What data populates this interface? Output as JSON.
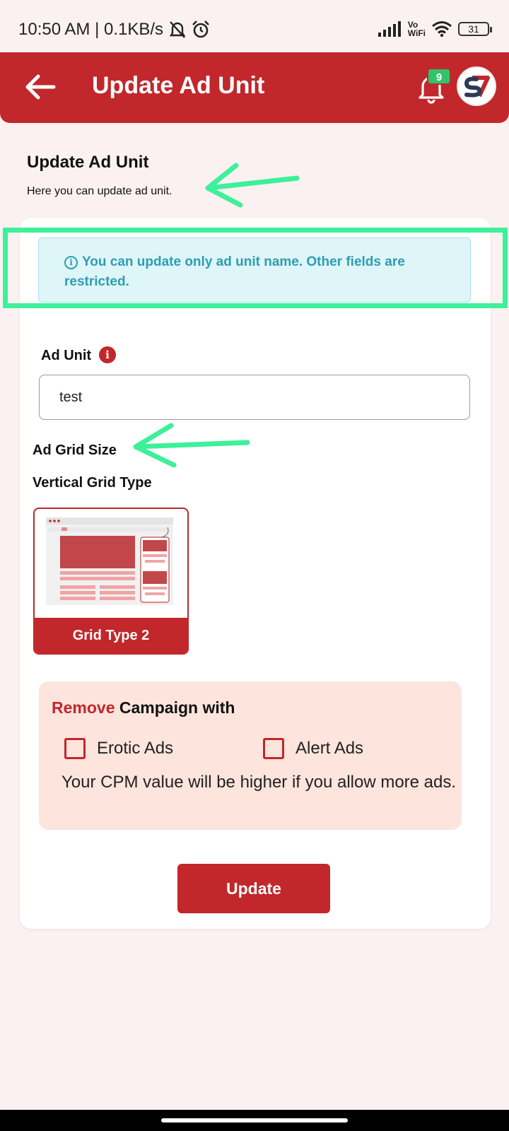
{
  "status_bar": {
    "time": "10:50 AM | 0.1KB/s",
    "vowifi_top": "Vo",
    "vowifi_bottom": "WiFi",
    "battery": "31"
  },
  "header": {
    "title": "Update Ad Unit",
    "notification_count": "9"
  },
  "page": {
    "title": "Update Ad Unit",
    "subtitle": "Here you can update ad unit."
  },
  "notice": {
    "text": "You can update only ad unit name. Other fields are restricted."
  },
  "form": {
    "ad_unit_label": "Ad Unit",
    "ad_unit_value": "test",
    "grid_size_label": "Ad Grid Size",
    "grid_type_label": "Vertical Grid Type",
    "grid_option_label": "Grid Type 2"
  },
  "campaign": {
    "title_highlight": "Remove",
    "title_rest": " Campaign with",
    "options": [
      {
        "label": "Erotic Ads",
        "checked": false
      },
      {
        "label": "Alert Ads",
        "checked": false
      }
    ],
    "note": "Your CPM value will be higher if you allow more ads."
  },
  "actions": {
    "update_label": "Update"
  },
  "colors": {
    "brand_red": "#c1272b",
    "annotation_green": "#3df09a",
    "notice_text": "#2e9db3",
    "campaign_bg": "#fde4dc"
  },
  "icons": [
    "back-arrow-icon",
    "bell-icon",
    "avatar-logo",
    "info-circle-icon",
    "info-icon",
    "checkbox",
    "signal-icon",
    "wifi-icon",
    "battery-icon",
    "mute-icon",
    "alarm-icon"
  ]
}
